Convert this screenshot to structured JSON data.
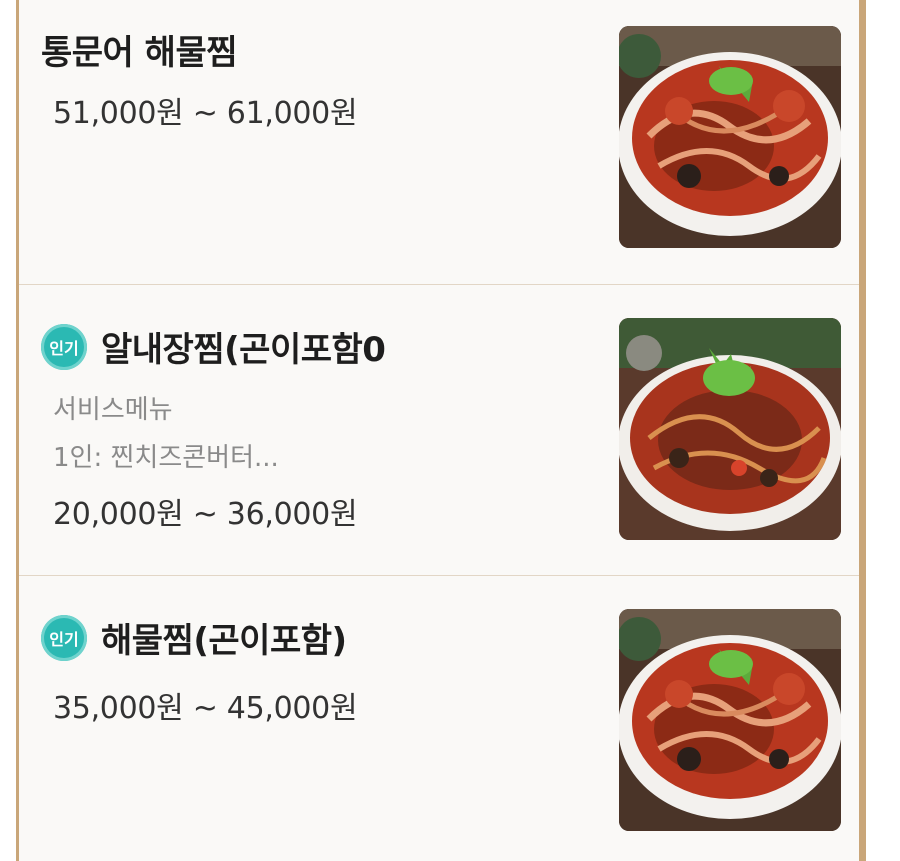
{
  "menu_items": [
    {
      "title": "통문어 해물찜",
      "badge": "",
      "description": [],
      "price": "51,000원 ~ 61,000원",
      "image_icon": "seafood-braise-dish-image"
    },
    {
      "title": "알내장찜(곤이포함0",
      "badge": "인기",
      "description": [
        "서비스메뉴",
        "1인: 찐치즈콘버터..."
      ],
      "price": "20,000원 ~ 36,000원",
      "image_icon": "seafood-braise-dish-image"
    },
    {
      "title": "해물찜(곤이포함)",
      "badge": "인기",
      "description": [],
      "price": "35,000원 ~ 45,000원",
      "image_icon": "seafood-braise-dish-image"
    }
  ],
  "colors": {
    "badge": "#2bb9b3",
    "frame_border": "#c9a679",
    "panel_bg": "#faf9f7"
  }
}
